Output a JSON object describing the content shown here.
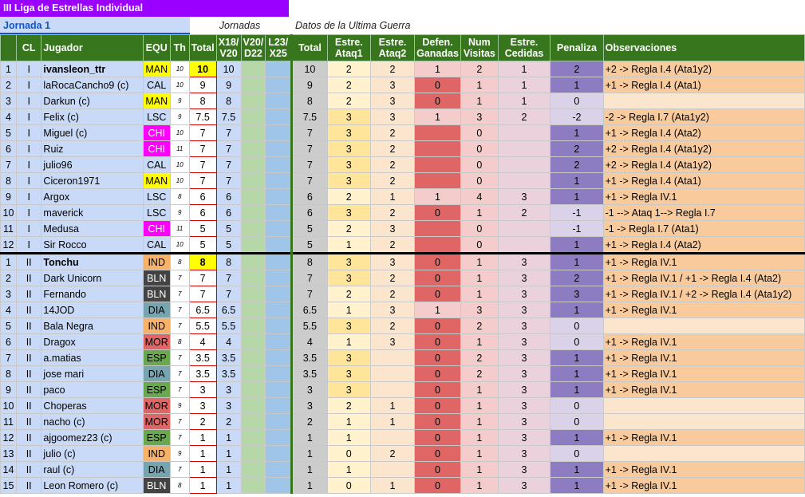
{
  "title": "III Liga de Estrellas Individual",
  "jornada_label": "Jornada 1",
  "jornadas_label": "Jornadas",
  "datos_label": "Datos de la Ultima Guerra",
  "colors": {
    "MAN": "#ffff00",
    "CAL": "#c9daf8",
    "LSC": "#c9daf8",
    "CHI": "#ff00ff",
    "IND": "#f6b26b",
    "BLN": "#434343",
    "DIA": "#76a5af",
    "MOR": "#e06666",
    "ESP": "#6aa84f",
    "defen_high": "#e06666",
    "defen_low": "#f4cccc",
    "ata1_high": "#ffe599",
    "pen_high": "#8e7cc3",
    "pen_low": "#d9d2e9",
    "obs_high": "#f9cb9c"
  },
  "headers": {
    "num": "",
    "cl": "CL",
    "jugador": "Jugador",
    "equ": "EQU",
    "th": "Th",
    "total": "Total",
    "x18": "X18/ V20",
    "v20": "V20/ D22",
    "l23": "L23/ X25",
    "total2": "Total",
    "ata1": "Estre. Ataq1",
    "ata2": "Estre. Ataq2",
    "defen": "Defen. Ganadas",
    "visitas": "Num Visitas",
    "cedidas": "Estre. Cedidas",
    "penaliza": "Penaliza",
    "obs": "Observaciones"
  },
  "rows": [
    {
      "n": "1",
      "cl": "I",
      "jug": "ivansleon_ttr",
      "equ": "MAN",
      "th": "10",
      "tot": "10",
      "x18": "10",
      "t2": "10",
      "a1": "2",
      "a2": "2",
      "def": "1",
      "vis": "2",
      "ced": "1",
      "pen": "2",
      "obs": "+2 -> Regla I.4 (Ata1y2)",
      "bold": true
    },
    {
      "n": "2",
      "cl": "I",
      "jug": "laRocaCancho9 (c)",
      "equ": "CAL",
      "th": "10",
      "tot": "9",
      "x18": "9",
      "t2": "9",
      "a1": "2",
      "a2": "3",
      "def": "0",
      "vis": "1",
      "ced": "1",
      "pen": "1",
      "obs": "+1 -> Regla I.4 (Ata1)"
    },
    {
      "n": "3",
      "cl": "I",
      "jug": "Darkun (c)",
      "equ": "MAN",
      "th": "9",
      "tot": "8",
      "x18": "8",
      "t2": "8",
      "a1": "2",
      "a2": "3",
      "def": "0",
      "vis": "1",
      "ced": "1",
      "pen": "0",
      "obs": ""
    },
    {
      "n": "4",
      "cl": "I",
      "jug": "Felix (c)",
      "equ": "LSC",
      "th": "9",
      "tot": "7.5",
      "x18": "7.5",
      "t2": "7.5",
      "a1": "3",
      "a2": "3",
      "def": "1",
      "vis": "3",
      "ced": "2",
      "pen": "-2",
      "obs": "-2 -> Regla I.7 (Ata1y2)"
    },
    {
      "n": "5",
      "cl": "I",
      "jug": "Miguel (c)",
      "equ": "CHI",
      "th": "10",
      "tot": "7",
      "x18": "7",
      "t2": "7",
      "a1": "3",
      "a2": "2",
      "def": "",
      "vis": "0",
      "ced": "",
      "pen": "1",
      "obs": "+1 -> Regla I.4 (Ata2)"
    },
    {
      "n": "6",
      "cl": "I",
      "jug": "Ruiz",
      "equ": "CHI",
      "th": "11",
      "tot": "7",
      "x18": "7",
      "t2": "7",
      "a1": "3",
      "a2": "2",
      "def": "",
      "vis": "0",
      "ced": "",
      "pen": "2",
      "obs": "+2 -> Regla I.4 (Ata1y2)"
    },
    {
      "n": "7",
      "cl": "I",
      "jug": "julio96",
      "equ": "CAL",
      "th": "10",
      "tot": "7",
      "x18": "7",
      "t2": "7",
      "a1": "3",
      "a2": "2",
      "def": "",
      "vis": "0",
      "ced": "",
      "pen": "2",
      "obs": "+2 -> Regla I.4 (Ata1y2)"
    },
    {
      "n": "8",
      "cl": "I",
      "jug": "Ciceron1971",
      "equ": "MAN",
      "th": "10",
      "tot": "7",
      "x18": "7",
      "t2": "7",
      "a1": "3",
      "a2": "2",
      "def": "",
      "vis": "0",
      "ced": "",
      "pen": "1",
      "obs": "+1 -> Regla I.4 (Ata1)"
    },
    {
      "n": "9",
      "cl": "I",
      "jug": "Argox",
      "equ": "LSC",
      "th": "8",
      "tot": "6",
      "x18": "6",
      "t2": "6",
      "a1": "2",
      "a2": "1",
      "def": "1",
      "vis": "4",
      "ced": "3",
      "pen": "1",
      "obs": "+1 -> Regla IV.1"
    },
    {
      "n": "10",
      "cl": "I",
      "jug": "maverick",
      "equ": "LSC",
      "th": "9",
      "tot": "6",
      "x18": "6",
      "t2": "6",
      "a1": "3",
      "a2": "2",
      "def": "0",
      "vis": "1",
      "ced": "2",
      "pen": "-1",
      "obs": "-1 --> Ataq 1--> Regla I.7"
    },
    {
      "n": "11",
      "cl": "I",
      "jug": "Medusa",
      "equ": "CHI",
      "th": "11",
      "tot": "5",
      "x18": "5",
      "t2": "5",
      "a1": "2",
      "a2": "3",
      "def": "",
      "vis": "0",
      "ced": "",
      "pen": "-1",
      "obs": "-1 -> Regla I.7 (Ata1)"
    },
    {
      "n": "12",
      "cl": "I",
      "jug": "Sir Rocco",
      "equ": "CAL",
      "th": "10",
      "tot": "5",
      "x18": "5",
      "t2": "5",
      "a1": "1",
      "a2": "2",
      "def": "",
      "vis": "0",
      "ced": "",
      "pen": "1",
      "obs": "+1 -> Regla I.4 (Ata2)"
    },
    {
      "n": "1",
      "cl": "II",
      "jug": "Tonchu",
      "equ": "IND",
      "th": "8",
      "tot": "8",
      "x18": "8",
      "t2": "8",
      "a1": "3",
      "a2": "3",
      "def": "0",
      "vis": "1",
      "ced": "3",
      "pen": "1",
      "obs": "+1 -> Regla IV.1",
      "bold": true,
      "sep": true
    },
    {
      "n": "2",
      "cl": "II",
      "jug": "Dark Unicorn",
      "equ": "BLN",
      "th": "7",
      "tot": "7",
      "x18": "7",
      "t2": "7",
      "a1": "3",
      "a2": "2",
      "def": "0",
      "vis": "1",
      "ced": "3",
      "pen": "2",
      "obs": "+1 -> Regla IV.1 / +1 -> Regla I.4 (Ata2)"
    },
    {
      "n": "3",
      "cl": "II",
      "jug": "Fernando",
      "equ": "BLN",
      "th": "7",
      "tot": "7",
      "x18": "7",
      "t2": "7",
      "a1": "2",
      "a2": "2",
      "def": "0",
      "vis": "1",
      "ced": "3",
      "pen": "3",
      "obs": "+1 -> Regla IV.1 / +2 -> Regla I.4 (Ata1y2)"
    },
    {
      "n": "4",
      "cl": "II",
      "jug": "14JOD",
      "equ": "DIA",
      "th": "7",
      "tot": "6.5",
      "x18": "6.5",
      "t2": "6.5",
      "a1": "1",
      "a2": "3",
      "def": "1",
      "vis": "3",
      "ced": "3",
      "pen": "1",
      "obs": "+1 -> Regla IV.1"
    },
    {
      "n": "5",
      "cl": "II",
      "jug": "Bala Negra",
      "equ": "IND",
      "th": "7",
      "tot": "5.5",
      "x18": "5.5",
      "t2": "5.5",
      "a1": "3",
      "a2": "2",
      "def": "0",
      "vis": "2",
      "ced": "3",
      "pen": "0",
      "obs": ""
    },
    {
      "n": "6",
      "cl": "II",
      "jug": "Dragox",
      "equ": "MOR",
      "th": "8",
      "tot": "4",
      "x18": "4",
      "t2": "4",
      "a1": "1",
      "a2": "3",
      "def": "0",
      "vis": "1",
      "ced": "3",
      "pen": "0",
      "obs": "+1 -> Regla IV.1"
    },
    {
      "n": "7",
      "cl": "II",
      "jug": "a.matias",
      "equ": "ESP",
      "th": "7",
      "tot": "3.5",
      "x18": "3.5",
      "t2": "3.5",
      "a1": "3",
      "a2": "",
      "def": "0",
      "vis": "2",
      "ced": "3",
      "pen": "1",
      "obs": "+1 -> Regla IV.1"
    },
    {
      "n": "8",
      "cl": "II",
      "jug": "jose mari",
      "equ": "DIA",
      "th": "7",
      "tot": "3.5",
      "x18": "3.5",
      "t2": "3.5",
      "a1": "3",
      "a2": "",
      "def": "0",
      "vis": "2",
      "ced": "3",
      "pen": "1",
      "obs": "+1 -> Regla IV.1"
    },
    {
      "n": "9",
      "cl": "II",
      "jug": "paco",
      "equ": "ESP",
      "th": "7",
      "tot": "3",
      "x18": "3",
      "t2": "3",
      "a1": "3",
      "a2": "",
      "def": "0",
      "vis": "1",
      "ced": "3",
      "pen": "1",
      "obs": "+1 -> Regla IV.1"
    },
    {
      "n": "10",
      "cl": "II",
      "jug": "Choperas",
      "equ": "MOR",
      "th": "9",
      "tot": "3",
      "x18": "3",
      "t2": "3",
      "a1": "2",
      "a2": "1",
      "def": "0",
      "vis": "1",
      "ced": "3",
      "pen": "0",
      "obs": ""
    },
    {
      "n": "11",
      "cl": "II",
      "jug": "nacho (c)",
      "equ": "MOR",
      "th": "7",
      "tot": "2",
      "x18": "2",
      "t2": "2",
      "a1": "1",
      "a2": "1",
      "def": "0",
      "vis": "1",
      "ced": "3",
      "pen": "0",
      "obs": ""
    },
    {
      "n": "12",
      "cl": "II",
      "jug": "ajgoomez23 (c)",
      "equ": "ESP",
      "th": "7",
      "tot": "1",
      "x18": "1",
      "t2": "1",
      "a1": "1",
      "a2": "",
      "def": "0",
      "vis": "1",
      "ced": "3",
      "pen": "1",
      "obs": "+1 -> Regla IV.1"
    },
    {
      "n": "13",
      "cl": "II",
      "jug": "julio (c)",
      "equ": "IND",
      "th": "9",
      "tot": "1",
      "x18": "1",
      "t2": "1",
      "a1": "0",
      "a2": "2",
      "def": "0",
      "vis": "1",
      "ced": "3",
      "pen": "0",
      "obs": ""
    },
    {
      "n": "14",
      "cl": "II",
      "jug": "raul (c)",
      "equ": "DIA",
      "th": "7",
      "tot": "1",
      "x18": "1",
      "t2": "1",
      "a1": "1",
      "a2": "",
      "def": "0",
      "vis": "1",
      "ced": "3",
      "pen": "1",
      "obs": "+1 -> Regla IV.1"
    },
    {
      "n": "15",
      "cl": "II",
      "jug": "Leon Romero (c)",
      "equ": "BLN",
      "th": "8",
      "tot": "1",
      "x18": "1",
      "t2": "1",
      "a1": "0",
      "a2": "1",
      "def": "0",
      "vis": "1",
      "ced": "3",
      "pen": "1",
      "obs": "+1 -> Regla IV.1"
    }
  ]
}
